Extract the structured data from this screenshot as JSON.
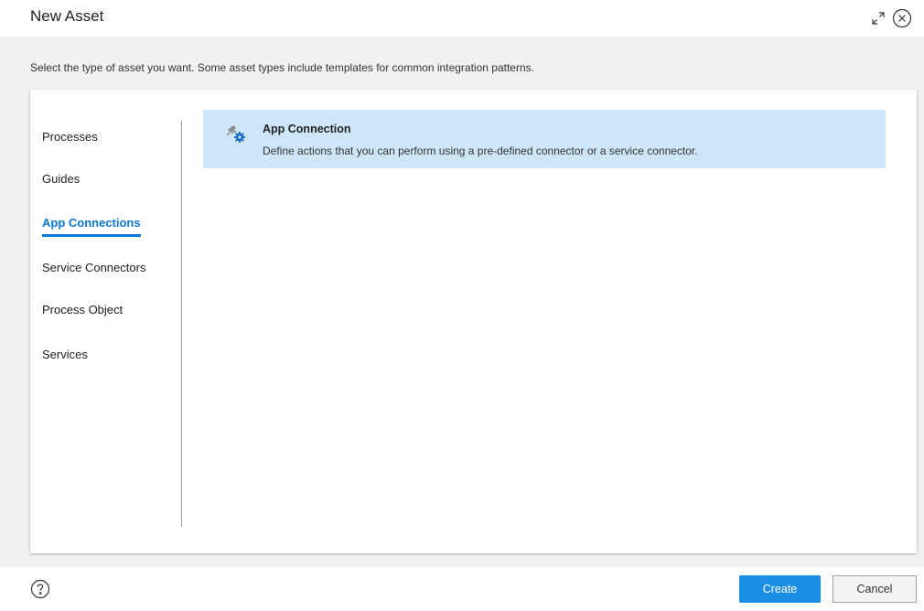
{
  "dialog": {
    "title": "New Asset",
    "instruction": "Select the type of asset you want. Some asset types include templates for common integration patterns."
  },
  "nav": {
    "items": [
      {
        "label": "Processes",
        "active": false
      },
      {
        "label": "Guides",
        "active": false
      },
      {
        "label": "App Connections",
        "active": true
      },
      {
        "label": "Service Connectors",
        "active": false
      },
      {
        "label": "Process Object",
        "active": false
      },
      {
        "label": "Services",
        "active": false
      }
    ]
  },
  "assets": [
    {
      "name": "App Connection",
      "description": "Define actions that you can perform using a pre-defined connector or a service connector.",
      "icon": "app-connection-icon",
      "selected": true
    }
  ],
  "footer": {
    "create_label": "Create",
    "cancel_label": "Cancel",
    "help_icon": "help-icon"
  },
  "colors": {
    "accent": "#0a78d7",
    "selected_bg": "#cde7f9",
    "primary_button": "#1b8fe6",
    "body_bg": "#f1f1f1"
  }
}
